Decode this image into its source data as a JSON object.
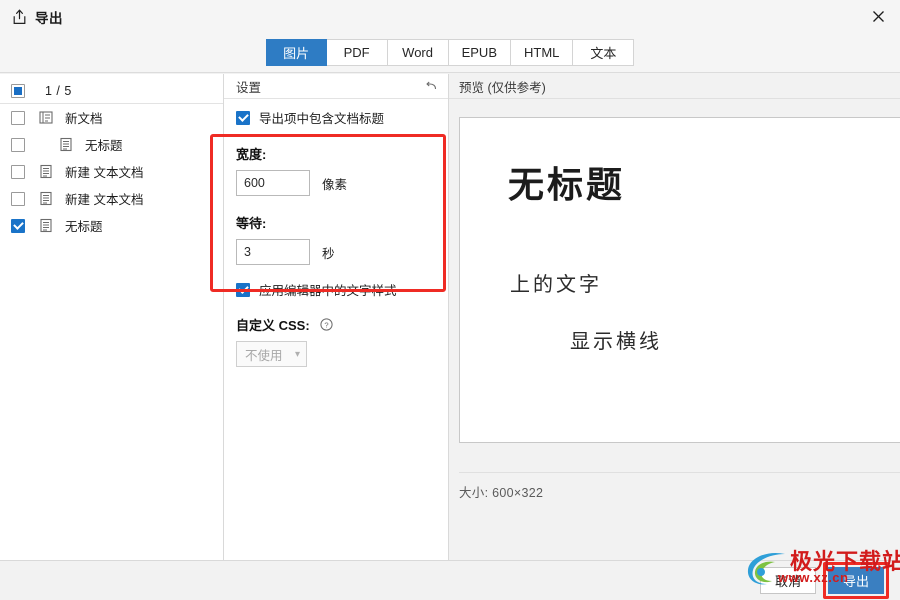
{
  "window": {
    "title": "导出",
    "title_icon": "export-upload-icon",
    "close_icon": "close-x-icon"
  },
  "tabs": [
    {
      "label": "图片",
      "active": true
    },
    {
      "label": "PDF",
      "active": false
    },
    {
      "label": "Word",
      "active": false
    },
    {
      "label": "EPUB",
      "active": false
    },
    {
      "label": "HTML",
      "active": false
    },
    {
      "label": "文本",
      "active": false
    }
  ],
  "tree": {
    "count_label": "1 / 5",
    "header_checkbox_state": "indeterminate",
    "items": [
      {
        "label": "新文档",
        "icon": "notebook-icon",
        "checked": false,
        "indent": 0
      },
      {
        "label": "无标题",
        "icon": "document-icon",
        "checked": false,
        "indent": 1
      },
      {
        "label": "新建 文本文档",
        "icon": "document-icon",
        "checked": false,
        "indent": 0
      },
      {
        "label": "新建 文本文档",
        "icon": "document-icon",
        "checked": false,
        "indent": 0
      },
      {
        "label": "无标题",
        "icon": "document-icon",
        "checked": true,
        "indent": 0
      }
    ]
  },
  "settings": {
    "header": "设置",
    "reset_icon": "undo-arrow-icon",
    "include_title_checkbox": {
      "label": "导出项中包含文档标题",
      "checked": true
    },
    "width": {
      "label": "宽度:",
      "value": "600",
      "unit": "像素"
    },
    "wait": {
      "label": "等待:",
      "value": "3",
      "unit": "秒"
    },
    "apply_editor_style_checkbox": {
      "label": "应用编辑器中的文字样式",
      "checked": true
    },
    "custom_css": {
      "label": "自定义 CSS:",
      "help_icon": "question-circle-icon",
      "selected": "不使用",
      "chevron_icon": "chevron-down-icon",
      "disabled": true
    },
    "highlight_color": "#ef2b24"
  },
  "preview": {
    "header": "预览 (仅供参考)",
    "document": {
      "title": "无标题",
      "line1": "上的文字",
      "line2": "显示横线"
    },
    "size_text": "大小: 600×322"
  },
  "footer": {
    "cancel_label": "取消",
    "export_label": "导出",
    "export_accent": "#3a7fc1",
    "export_highlight": "#ef2b24"
  },
  "watermark": {
    "text": "极光下载站",
    "sub": "www.xz.cn",
    "color": "#d21c1c",
    "logo_icon": "swirl-logo-icon"
  }
}
